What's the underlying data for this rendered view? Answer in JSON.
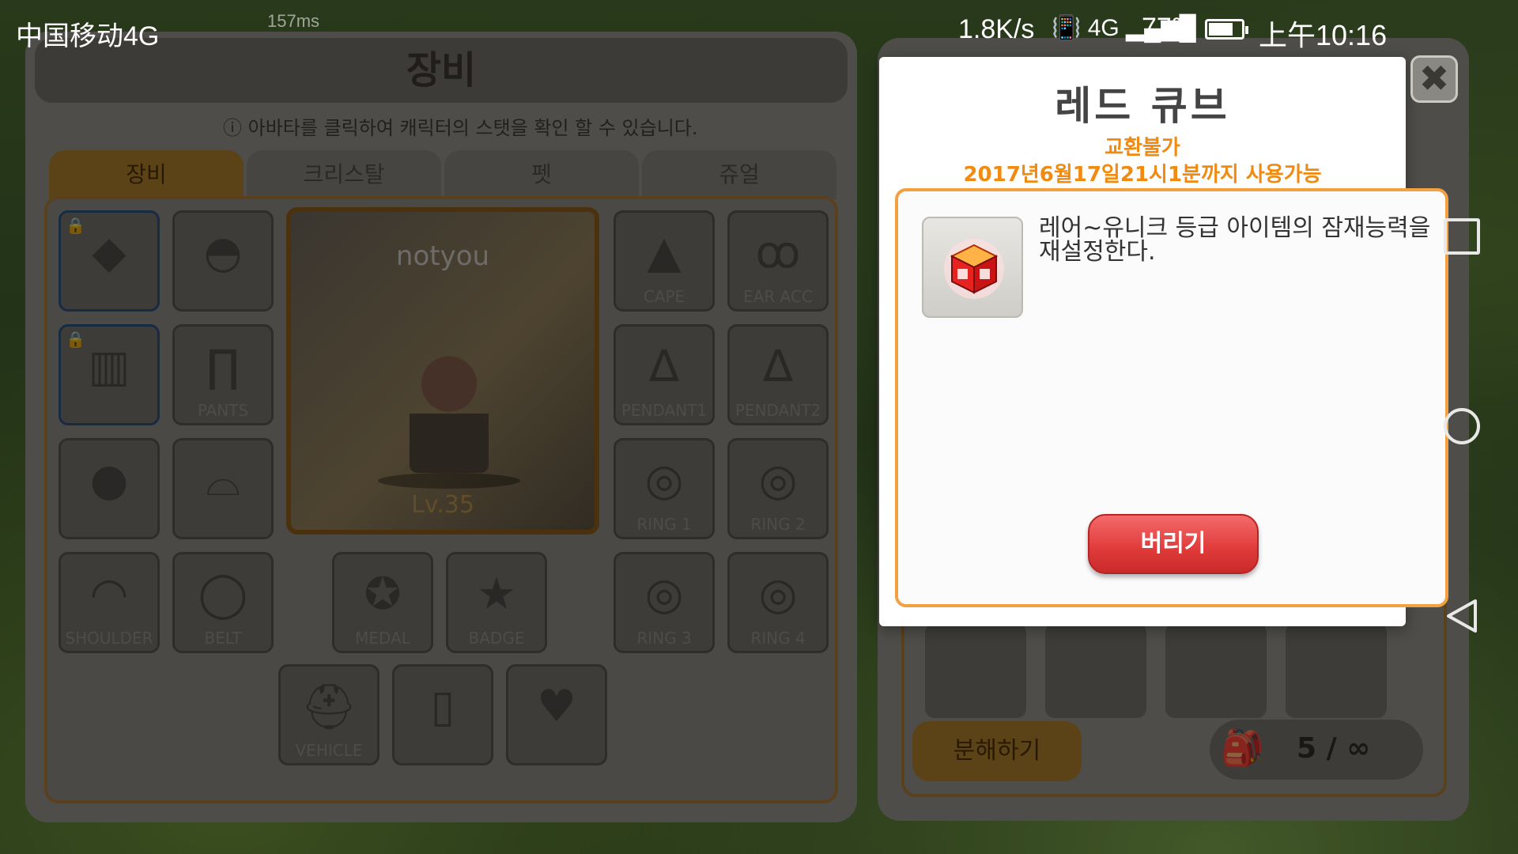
{
  "status_bar": {
    "carrier": "中国移动4G",
    "ping": "157ms",
    "net_speed": "1.8K/s",
    "signal": "📳 4G ▂▄▆█",
    "battery": "77%",
    "time": "上午10:16"
  },
  "equipment": {
    "title": "장비",
    "info_text": "아바타를 클릭하여 캐릭터의 스탯을 확인 할 수 있습니다.",
    "tabs": [
      "장비",
      "크리스탈",
      "펫",
      "쥬얼"
    ],
    "active_tab": 0,
    "character": {
      "name": "notyou",
      "level": "Lv.35"
    },
    "slots": {
      "cape": "CAPE",
      "ear_acc": "EAR ACC",
      "pendant1": "PENDANT1",
      "pendant2": "PENDANT2",
      "ring1": "RING 1",
      "ring2": "RING 2",
      "ring3": "RING 3",
      "ring4": "RING 4",
      "pants": "PANTS",
      "shoulder": "SHOULDER",
      "belt": "BELT",
      "medal": "MEDAL",
      "badge": "BADGE",
      "vehicle": "VEHICLE"
    }
  },
  "inventory": {
    "disassemble_label": "분해하기",
    "capacity": "5 / ∞"
  },
  "dialog": {
    "title": "레드 큐브",
    "tradeable": "교환불가",
    "expiry": "2017년6월17일21시1분까지 사용가능",
    "description": "레어~유니크 등급 아이템의 잠재능력을 재설정한다.",
    "discard_label": "버리기",
    "close_label": "✖",
    "item_icon": "red-cube-icon",
    "colors": {
      "accent": "#f08a10",
      "discard": "#e03a3a",
      "border": "#f2a040"
    }
  }
}
